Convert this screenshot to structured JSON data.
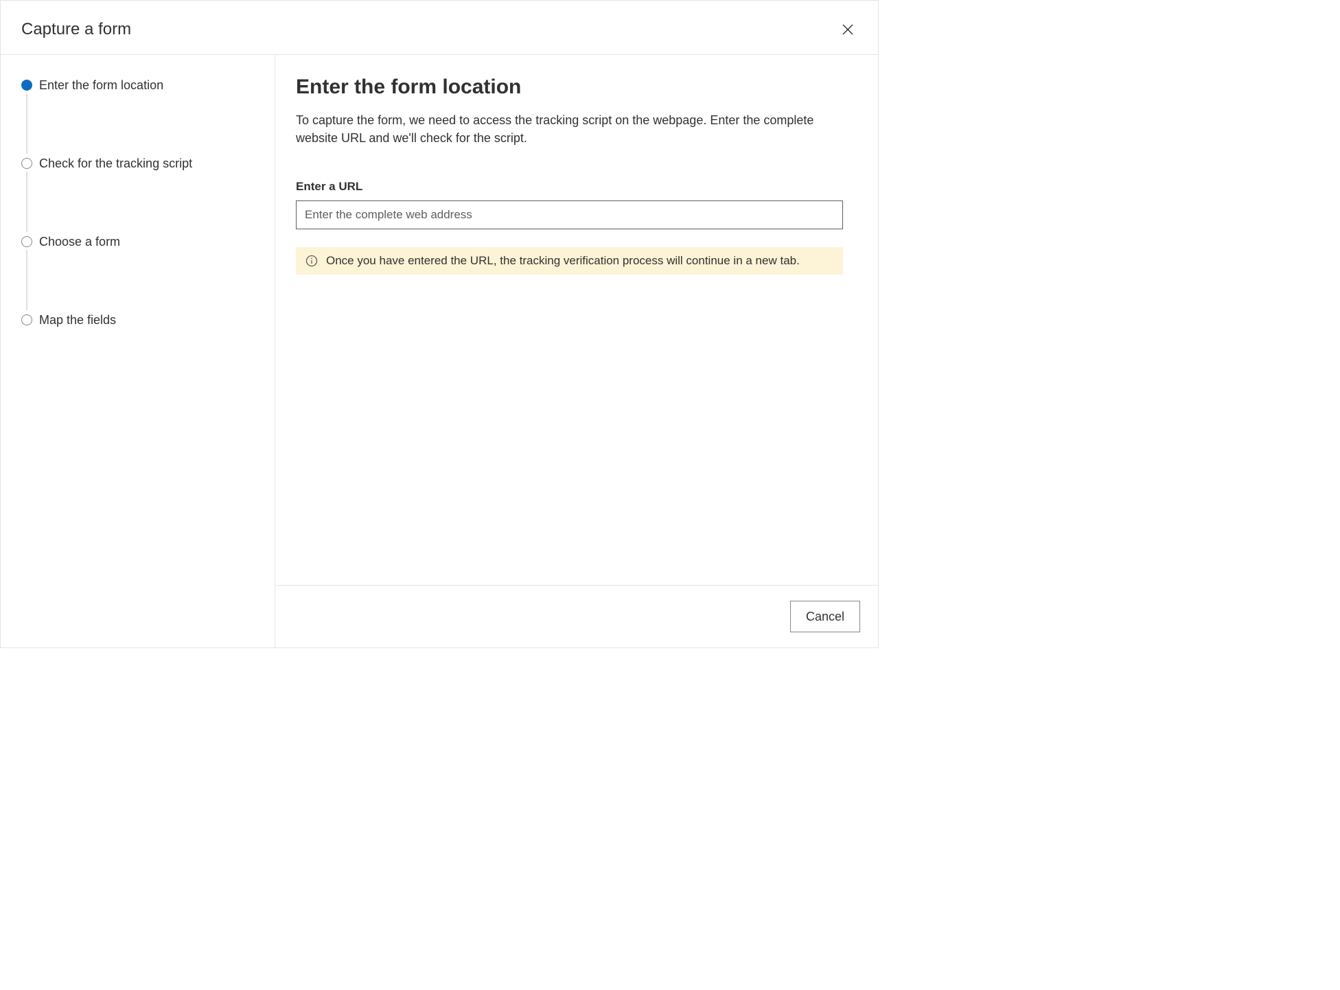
{
  "modal": {
    "title": "Capture a form"
  },
  "steps": [
    {
      "label": "Enter the form location",
      "active": true
    },
    {
      "label": "Check for the tracking script",
      "active": false
    },
    {
      "label": "Choose a form",
      "active": false
    },
    {
      "label": "Map the fields",
      "active": false
    }
  ],
  "main": {
    "heading": "Enter the form location",
    "description": "To capture the form, we need to access the tracking script on the webpage. Enter the complete website URL and we'll check for the script.",
    "url_field_label": "Enter a URL",
    "url_placeholder": "Enter the complete web address",
    "notice": "Once you have entered the URL, the tracking verification process will continue in a new tab."
  },
  "footer": {
    "cancel": "Cancel"
  }
}
